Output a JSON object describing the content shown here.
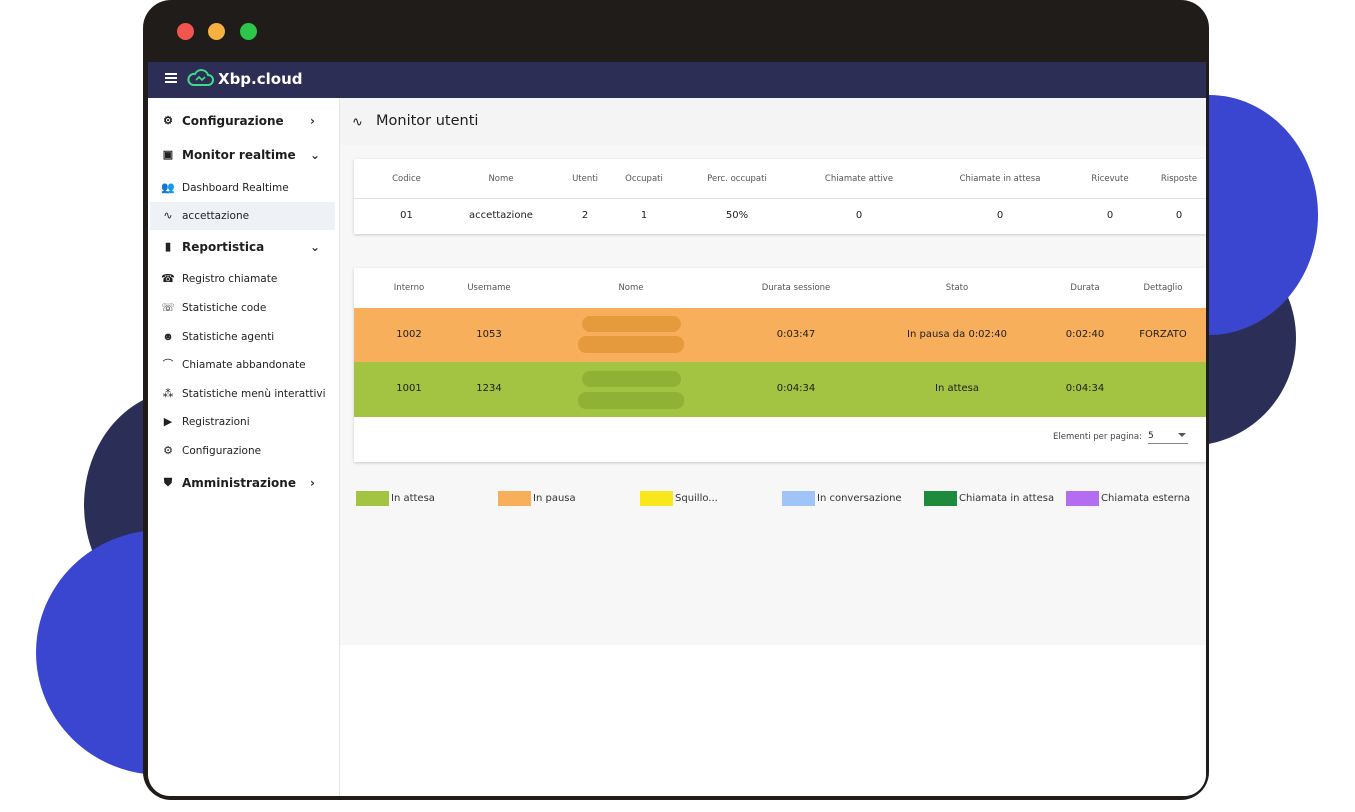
{
  "window": {
    "controls": [
      "close",
      "minimize",
      "maximize"
    ]
  },
  "app": {
    "brand": "Xbp.cloud",
    "menu_icon": "hamburger-icon",
    "logo_icon": "cloud-icon"
  },
  "sidebar": {
    "groups": [
      {
        "label": "Configurazione",
        "icon": "gear-icon",
        "expanded": false
      },
      {
        "label": "Monitor realtime",
        "icon": "monitor-icon",
        "expanded": true,
        "items": [
          {
            "label": "Dashboard Realtime",
            "icon": "people-icon"
          },
          {
            "label": "accettazione",
            "icon": "pulse-icon",
            "active": true
          }
        ]
      },
      {
        "label": "Reportistica",
        "icon": "bar-chart-icon",
        "expanded": true,
        "items": [
          {
            "label": "Registro chiamate",
            "icon": "phone-list-icon"
          },
          {
            "label": "Statistiche code",
            "icon": "phone-queue-icon"
          },
          {
            "label": "Statistiche agenti",
            "icon": "agent-icon"
          },
          {
            "label": "Chiamate abbandonate",
            "icon": "hangup-icon"
          },
          {
            "label": "Statistiche menù interattivi",
            "icon": "tree-icon"
          },
          {
            "label": "Registrazioni",
            "icon": "play-icon"
          },
          {
            "label": "Configurazione",
            "icon": "gear-icon"
          }
        ]
      },
      {
        "label": "Amministrazione",
        "icon": "shield-icon",
        "expanded": false
      }
    ]
  },
  "page": {
    "title": "Monitor utenti",
    "title_icon": "pulse-icon"
  },
  "queue_table": {
    "headers": [
      "Codice",
      "Nome",
      "Utenti",
      "Occupati",
      "Perc. occupati",
      "Chiamate attive",
      "Chiamate in attesa",
      "Ricevute",
      "Risposte"
    ],
    "rows": [
      [
        "01",
        "accettazione",
        "2",
        "1",
        "50%",
        "0",
        "0",
        "0",
        "0"
      ]
    ]
  },
  "agents_table": {
    "headers": [
      "Interno",
      "Username",
      "Nome",
      "Durata sessione",
      "Stato",
      "Durata",
      "Dettaglio"
    ],
    "rows": [
      {
        "interno": "1002",
        "username": "1053",
        "durata_sessione": "0:03:47",
        "stato": "In pausa da 0:02:40",
        "durata": "0:02:40",
        "dettaglio": "FORZATO",
        "color": "#f8af5c"
      },
      {
        "interno": "1001",
        "username": "1234",
        "durata_sessione": "0:04:34",
        "stato": "In attesa",
        "durata": "0:04:34",
        "dettaglio": "",
        "color": "#a2c442"
      }
    ],
    "pager": {
      "label": "Elementi per pagina:",
      "value": "5"
    }
  },
  "legend": [
    {
      "label": "In attesa",
      "color": "#a2c442"
    },
    {
      "label": "In pausa",
      "color": "#f8af5c"
    },
    {
      "label": "Squillo...",
      "color": "#f8e71c"
    },
    {
      "label": "In conversazione",
      "color": "#a0c4f8"
    },
    {
      "label": "Chiamata in attesa",
      "color": "#1e8a3c"
    },
    {
      "label": "Chiamata esterna",
      "color": "#b46cf0"
    }
  ]
}
